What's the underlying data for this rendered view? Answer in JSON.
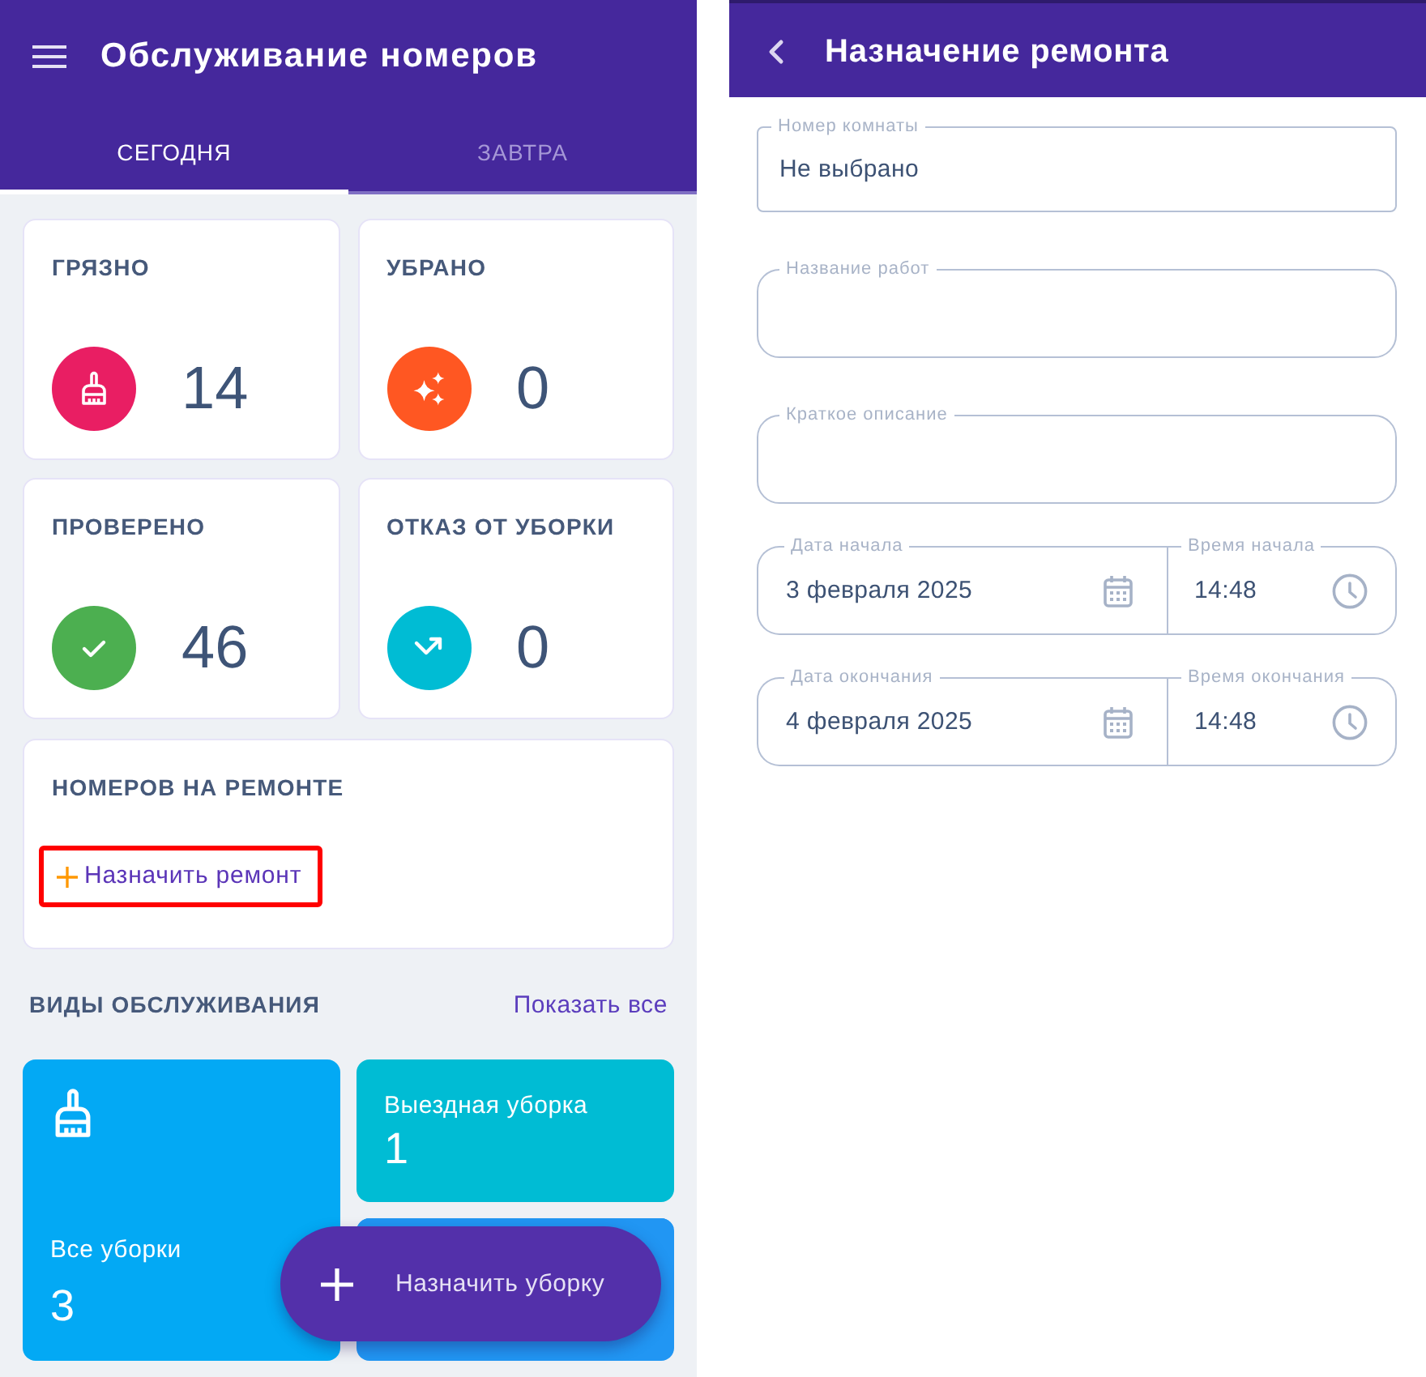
{
  "main_screen": {
    "app_bar": {
      "title": "Обслуживание номеров"
    },
    "tabs": [
      {
        "label": "СЕГОДНЯ",
        "selected": true
      },
      {
        "label": "ЗАВТРА",
        "selected": false
      }
    ],
    "status_cards": [
      {
        "kind": "dirty",
        "label": "ГРЯЗНО",
        "count": "14",
        "color": "#e91e63"
      },
      {
        "kind": "cleaned",
        "label": "УБРАНО",
        "count": "0",
        "color": "#ff5722"
      },
      {
        "kind": "inspected",
        "label": "ПРОВЕРЕНО",
        "count": "46",
        "color": "#4caf50"
      },
      {
        "kind": "refused",
        "label": "ОТКАЗ ОТ УБОРКИ",
        "count": "0",
        "color": "#00bcd4"
      }
    ],
    "repair_card": {
      "title": "НОМЕРОВ НА РЕМОНТЕ",
      "action": {
        "label": "Назначить ремонт",
        "highlighted": true
      }
    },
    "services": {
      "title": "ВИДЫ ОБСЛУЖИВАНИЯ",
      "show_all": "Показать все",
      "tiles": [
        {
          "kind": "featured",
          "label": "Все уборки",
          "count": "3",
          "color": "#03a9f4"
        },
        {
          "kind": "compact",
          "label": "Выездная уборка",
          "count": "1",
          "color": "#00bcd4"
        },
        {
          "kind": "covered",
          "color": "#2196f3"
        }
      ]
    },
    "fab": {
      "label": "Назначить уборку"
    }
  },
  "repair_form": {
    "app_bar": {
      "title": "Назначение ремонта"
    },
    "fields": [
      {
        "kind": "select",
        "label": "Номер комнаты",
        "value": "Не выбрано"
      },
      {
        "kind": "text",
        "label": "Название работ"
      },
      {
        "kind": "text",
        "label": "Краткое описание"
      },
      {
        "kind": "datetime",
        "date": {
          "label": "Дата начала",
          "value": "3 февраля 2025"
        },
        "time": {
          "label": "Время начала",
          "value": "14:48"
        }
      },
      {
        "kind": "datetime",
        "date": {
          "label": "Дата окончания",
          "value": "4 февраля 2025"
        },
        "time": {
          "label": "Время окончания",
          "value": "14:48"
        }
      }
    ]
  }
}
